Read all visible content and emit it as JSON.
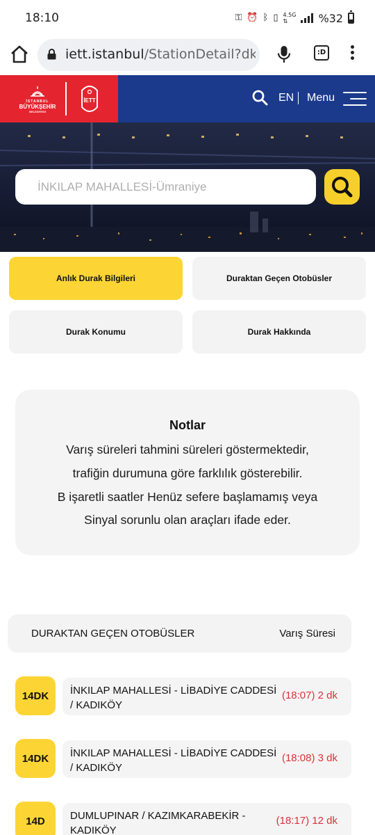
{
  "status_bar": {
    "time": "18:10",
    "network": "4.5G",
    "battery": "%32",
    "icons": [
      "key-icon",
      "alarm-icon",
      "bluetooth-icon",
      "vibrate-icon",
      "data-arrows-icon",
      "signal-icon",
      "battery-icon"
    ]
  },
  "browser": {
    "url_host": "iett.istanbul",
    "url_path": "/StationDetail?dko",
    "tabs_label": ":D"
  },
  "header": {
    "ibb_line1": "İSTANBUL",
    "ibb_line2": "BÜYÜKŞEHİR",
    "ibb_line3": "BELEDİYESİ",
    "iett_logo_text": "İETT",
    "lang": "EN",
    "menu": "Menu",
    "colors": {
      "brand_red": "#e4252f",
      "brand_blue": "#1b3a8c",
      "accent_yellow": "#fcd535"
    }
  },
  "search": {
    "placeholder": "İNKILAP MAHALLESİ-Ümraniye"
  },
  "tabs": [
    {
      "label": "Anlık Durak Bilgileri",
      "active": true
    },
    {
      "label": "Duraktan Geçen Otobüsler",
      "active": false
    },
    {
      "label": "Durak Konumu",
      "active": false
    },
    {
      "label": "Durak Hakkında",
      "active": false
    }
  ],
  "notes": {
    "title": "Notlar",
    "lines": [
      "Varış süreleri tahmini süreleri göstermektedir,",
      "trafiğin durumuna göre farklılık gösterebilir.",
      "B işaretli saatler Henüz sefere başlamamış veya",
      "Sinyal sorunlu olan araçları ifade eder."
    ]
  },
  "bus_list": {
    "header_left": "DURAKTAN GEÇEN OTOBÜSLER",
    "header_right": "Varış Süresi",
    "rows": [
      {
        "route": "14DK",
        "destination": "İNKILAP MAHALLESİ - LİBADİYE CADDESİ / KADIKÖY",
        "eta": "(18:07) 2 dk"
      },
      {
        "route": "14DK",
        "destination": "İNKILAP MAHALLESİ - LİBADİYE CADDESİ / KADIKÖY",
        "eta": "(18:08) 3 dk"
      },
      {
        "route": "14D",
        "destination": "DUMLUPINAR / KAZIMKARABEKİR - KADIKÖY",
        "eta": "(18:17) 12 dk"
      }
    ]
  }
}
